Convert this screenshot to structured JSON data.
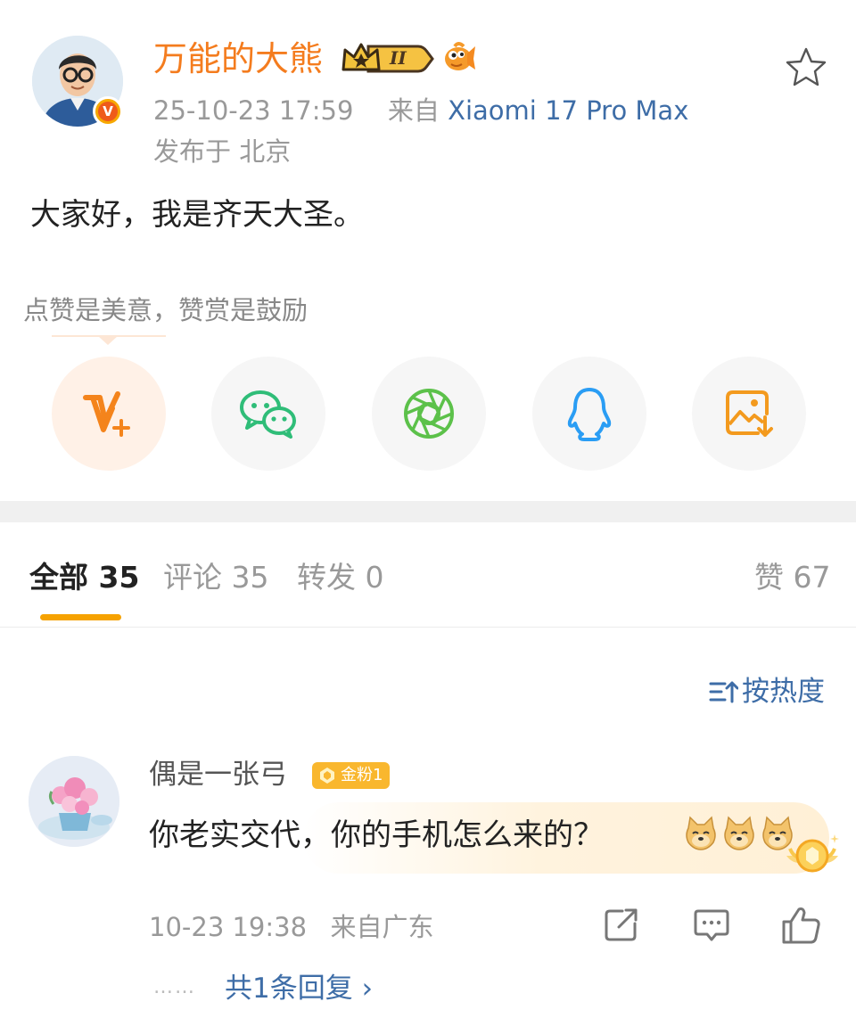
{
  "post": {
    "author": "万能的大熊",
    "level_badge": "II",
    "datetime": "25-10-23 17:59",
    "source_prefix": "来自",
    "device": "Xiaomi 17 Pro Max",
    "location_prefix": "发布于",
    "location": "北京",
    "text": "大家好，我是齐天大圣。"
  },
  "reward": {
    "tip": "点赞是美意，赞赏是鼓励",
    "share_icons": [
      "reward-v-icon",
      "wechat-icon",
      "moments-icon",
      "qq-icon",
      "save-image-icon"
    ]
  },
  "tabs": {
    "all": "全部 35",
    "comments": "评论 35",
    "reposts": "转发 0",
    "likes": "赞 67"
  },
  "sort": {
    "label": "按热度"
  },
  "comment": {
    "user": "偶是一张弓",
    "fan_badge": "金粉1",
    "text": "你老实交代，你的手机怎么来的？",
    "datetime": "10-23 19:38",
    "source": "来自广东",
    "dots": "……",
    "replies_link": "共1条回复 ›"
  },
  "colors": {
    "username": "#f47c1e",
    "link": "#3e6da7",
    "tab_indicator": "#f6a200",
    "fan_badge": "#f9b72e"
  }
}
